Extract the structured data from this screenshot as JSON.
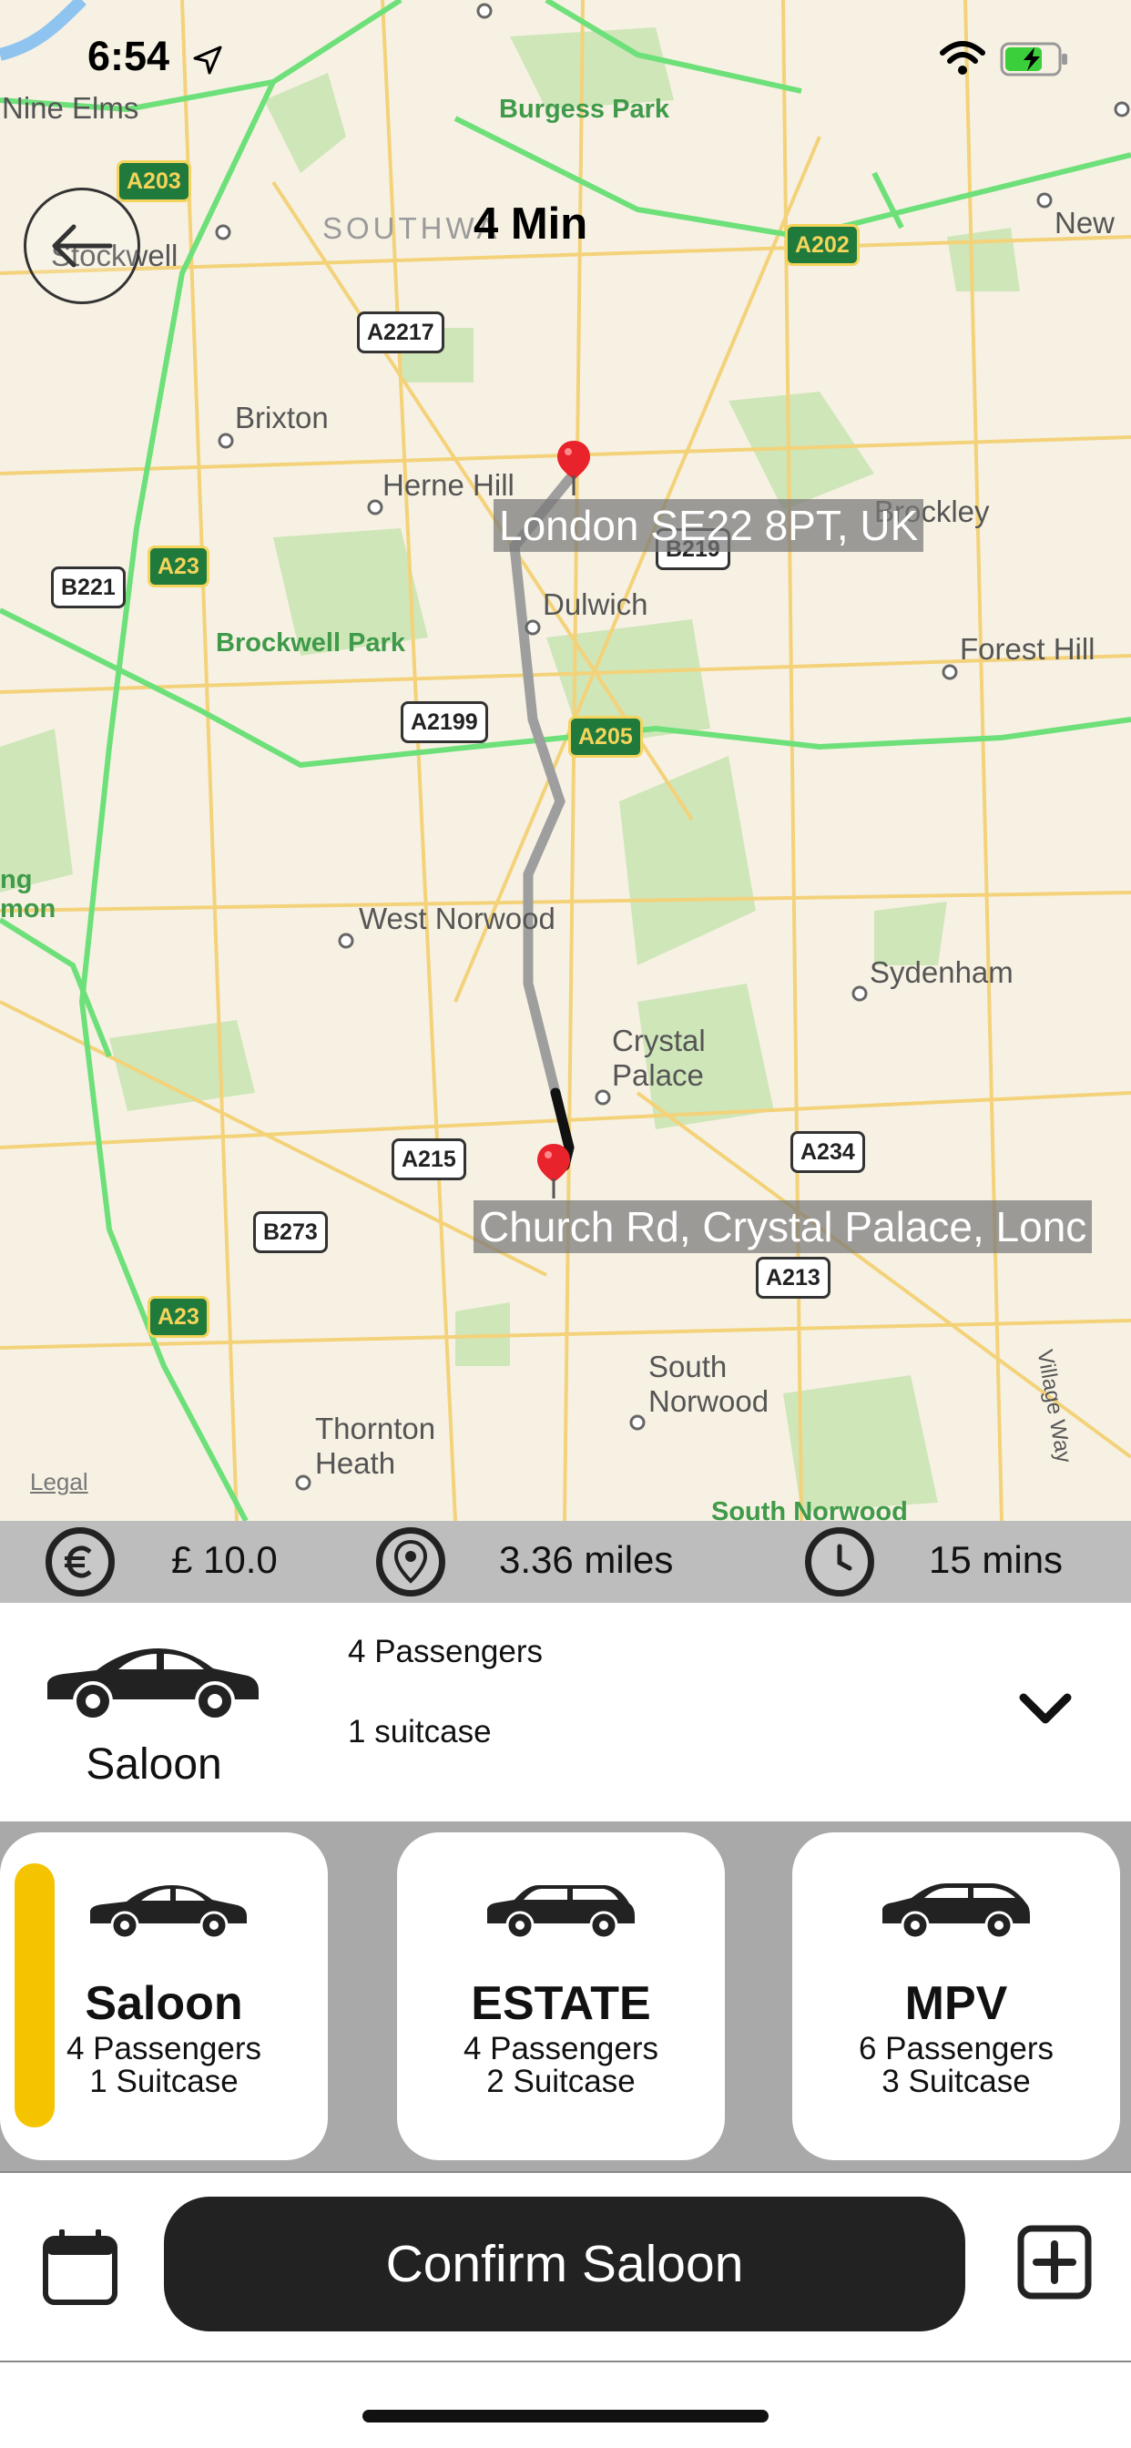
{
  "status_bar": {
    "time": "6:54"
  },
  "header": {
    "eta": "4 Min"
  },
  "map": {
    "pickup_label": "London SE22 8PT, UK",
    "dropoff_label": "Church Rd, Crystal Palace, Lonc",
    "legal": "Legal",
    "places": [
      "Nine Elms",
      "Stockwell",
      "SOUTHWA",
      "Brixton",
      "Herne Hill",
      "Dulwich",
      "Brockley",
      "Forest Hill",
      "West Norwood",
      "Sydenham",
      "Crystal",
      "Palace",
      "South",
      "Norwood",
      "Thornton",
      "Heath",
      "New",
      "ng",
      "mon",
      "Village Way"
    ],
    "parks": [
      "Burgess Park",
      "Brockwell Park",
      "South Norwood"
    ],
    "roads": [
      "A203",
      "A202",
      "A2217",
      "A23",
      "B221",
      "B219",
      "A2199",
      "A205",
      "A215",
      "A234",
      "B273",
      "A213",
      "A23"
    ]
  },
  "trip_info": {
    "price": "£ 10.0",
    "distance": "3.36 miles",
    "duration": "15 mins"
  },
  "selected_vehicle": {
    "name": "Saloon",
    "passengers": "4 Passengers",
    "luggage": "1 suitcase"
  },
  "vehicle_options": [
    {
      "title": "Saloon",
      "passengers": "4 Passengers",
      "luggage": "1 Suitcase",
      "selected": true
    },
    {
      "title": "ESTATE",
      "passengers": "4 Passengers",
      "luggage": "2 Suitcase",
      "selected": false
    },
    {
      "title": "MPV",
      "passengers": "6 Passengers",
      "luggage": "3 Suitcase",
      "selected": false
    }
  ],
  "actions": {
    "confirm_label": "Confirm Saloon"
  },
  "colors": {
    "accent": "#f5c400",
    "button": "#222222",
    "route": "#9e9e9e",
    "pin": "#e8232b"
  },
  "icons": [
    "back-arrow-icon",
    "location-arrow-icon",
    "wifi-icon",
    "battery-icon",
    "euro-icon",
    "map-pin-icon",
    "clock-icon",
    "car-icon",
    "chevron-down-icon",
    "calendar-icon",
    "plus-square-icon",
    "map-pin-icon"
  ]
}
